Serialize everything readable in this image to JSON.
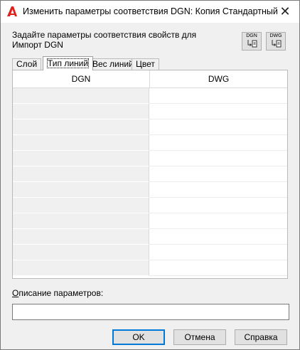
{
  "window": {
    "title": "Изменить параметры соответствия DGN:  Копия Стандартный",
    "app_icon": "autocad-a-icon",
    "close_icon": "close-icon",
    "close_glyph": "✕"
  },
  "instruction": {
    "line1": "Задайте параметры соответствия свойств для",
    "line2": "Импорт DGN"
  },
  "tool_buttons": [
    {
      "caption": "DGN",
      "icon": "dgn-import-icon"
    },
    {
      "caption": "DWG",
      "icon": "dwg-import-icon"
    }
  ],
  "tabs": [
    {
      "label": "Слой",
      "active": false
    },
    {
      "label": "Тип линий",
      "active": true
    },
    {
      "label": "Вес линий",
      "active": false
    },
    {
      "label": "Цвет",
      "active": false
    }
  ],
  "grid": {
    "columns": [
      "DGN",
      "DWG"
    ],
    "rows": []
  },
  "description": {
    "label_underlined": "О",
    "label_rest": "писание параметров:",
    "value": ""
  },
  "buttons": {
    "ok": "OK",
    "cancel": "Отмена",
    "help": "Справка"
  },
  "colors": {
    "accent": "#0078d7",
    "app_icon_red": "#e0201b"
  }
}
